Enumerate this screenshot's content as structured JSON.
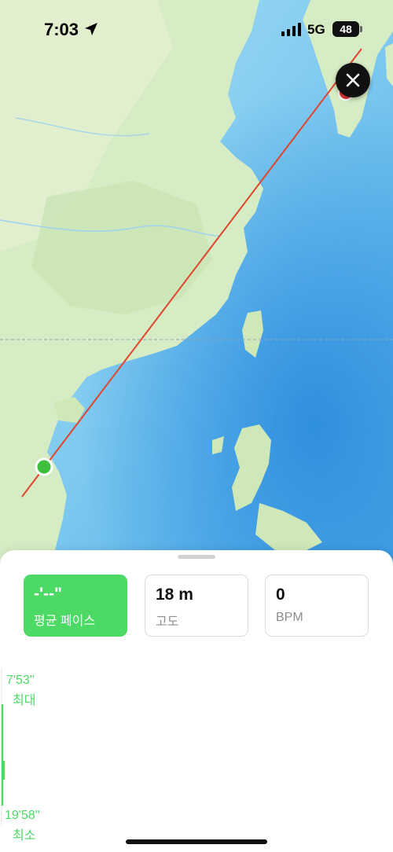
{
  "status_bar": {
    "time": "7:03",
    "network": "5G",
    "battery": "48"
  },
  "map": {
    "route_color": "#e0452e",
    "start_marker_color": "#3fbf3f"
  },
  "stats": {
    "pace": {
      "value": "-'--\"",
      "label": "평균 페이스",
      "color": "#4cd964"
    },
    "altitude": {
      "value": "18 m",
      "label": "고도"
    },
    "heart_rate": {
      "value": "0",
      "label": "BPM"
    }
  },
  "chart": {
    "max_value": "7'53''",
    "max_label": "최대",
    "min_value": "19'58''",
    "min_label": "최소"
  }
}
